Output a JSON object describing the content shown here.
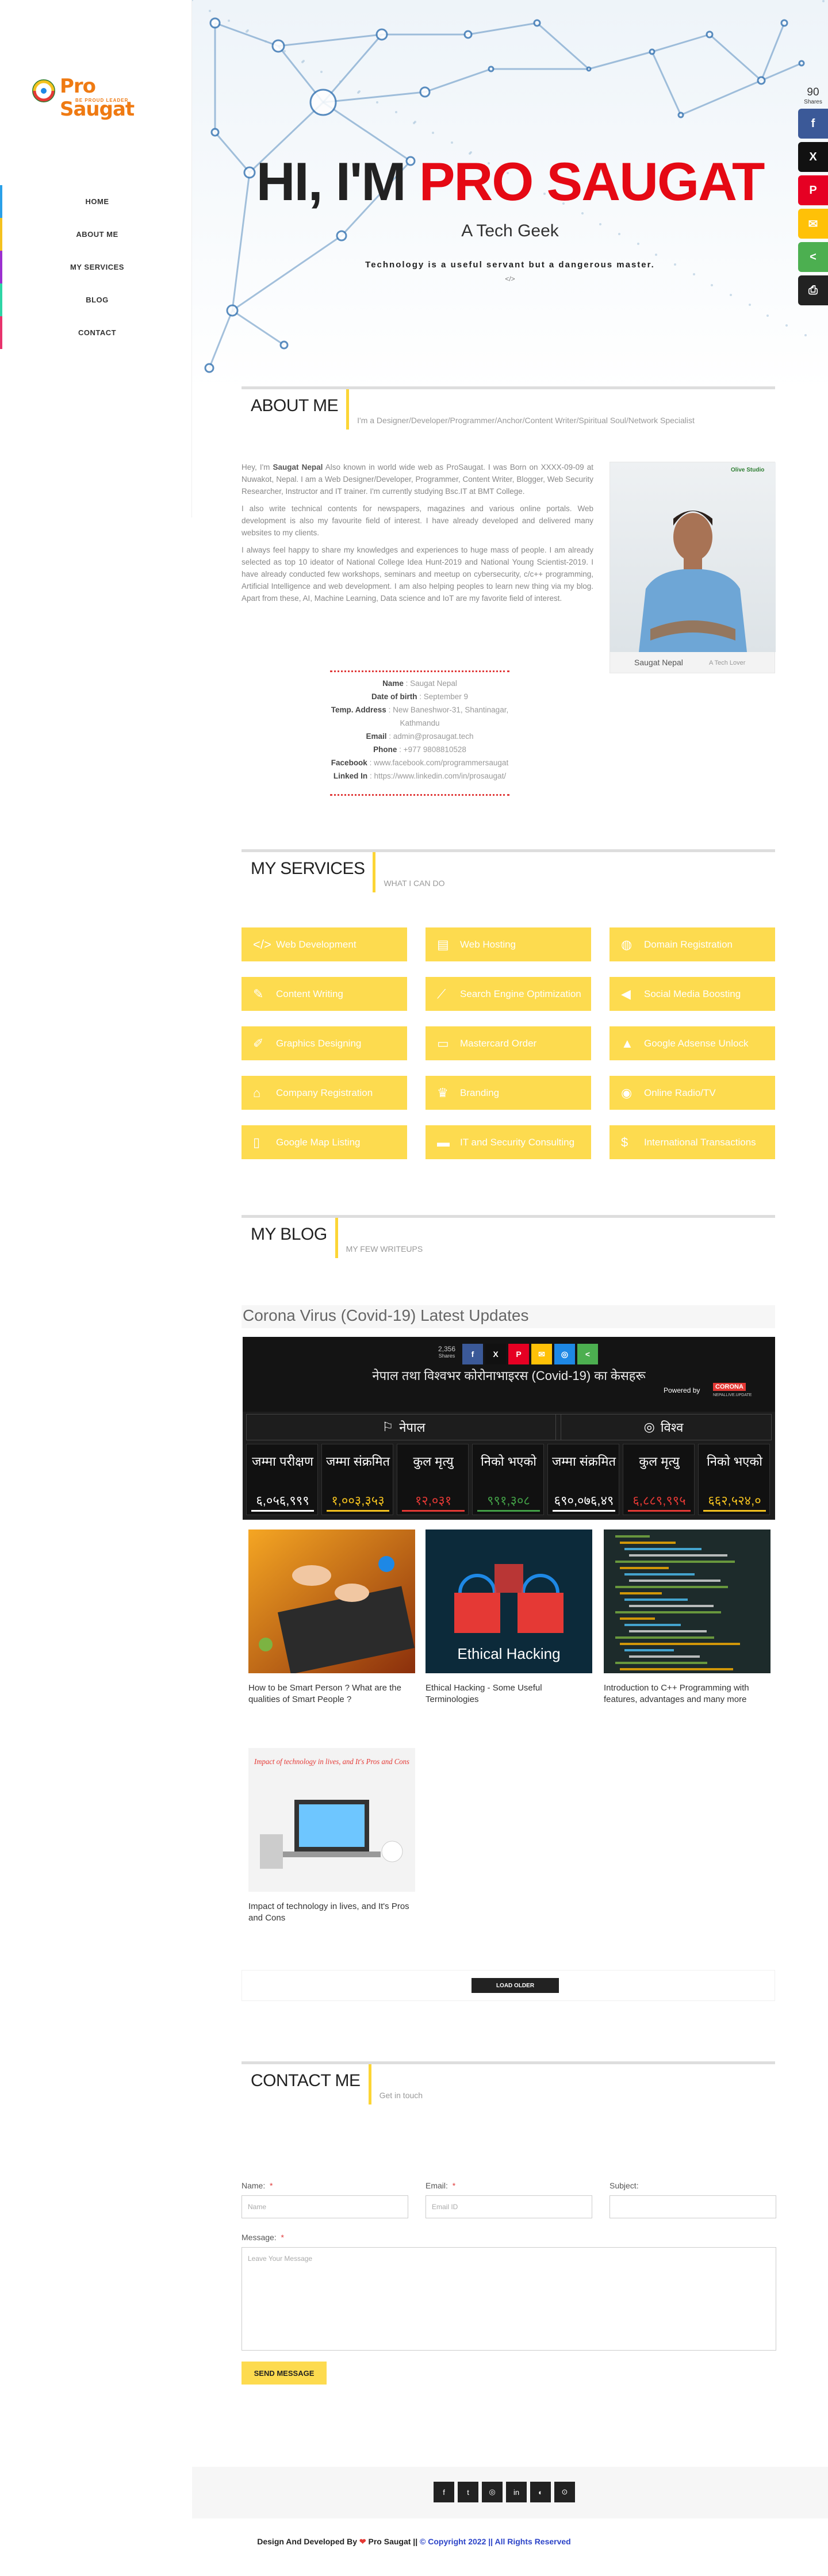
{
  "logo": {
    "title": "Pro Saugat",
    "subtitle": "BE PROUD LEADER"
  },
  "nav": [
    {
      "label": "HOME",
      "color": "#2aa0e8"
    },
    {
      "label": "ABOUT ME",
      "color": "#f4c21f"
    },
    {
      "label": "MY SERVICES",
      "color": "#9b30d0"
    },
    {
      "label": "BLOG",
      "color": "#2ed5a6"
    },
    {
      "label": "CONTACT",
      "color": "#e8336c"
    }
  ],
  "hero": {
    "title_dark": "HI, I'M",
    "title_red": "PRO SAUGAT",
    "subtitle": "A Tech Geek",
    "quote": "Technology is a useful servant but a dangerous master.",
    "code": "</>"
  },
  "share": {
    "count": "90",
    "label": "Shares",
    "buttons": [
      {
        "icon": "f",
        "color": "#3b5998"
      },
      {
        "icon": "X",
        "color": "#111111"
      },
      {
        "icon": "P",
        "color": "#e60023"
      },
      {
        "icon": "✉",
        "color": "#ffc107"
      },
      {
        "icon": "<",
        "color": "#4caf50"
      },
      {
        "icon": "⎙",
        "color": "#222222"
      }
    ]
  },
  "about": {
    "heading": "ABOUT ME",
    "subheading": "I'm a Designer/Developer/Programmer/Anchor/Content Writer/Spiritual Soul/Network Specialist",
    "p1_pre": "Hey, I'm ",
    "p1_name": "Saugat Nepal",
    "p1_post": " Also known in world wide web as ProSaugat. I was Born on XXXX-09-09 at Nuwakot, Nepal. I am a Web Designer/Developer, Programmer, Content Writer, Blogger, Web Security Researcher, Instructor and IT trainer. I'm currently studying Bsc.IT at BMT College.",
    "p2": "I also write technical contents for newspapers, magazines and various online portals. Web development is also my favourite field of interest. I have already developed and delivered many websites to my clients.",
    "p3": "I always feel happy to share my knowledges and experiences to huge mass of people. I am already selected as top 10 ideator of National College Idea Hunt-2019 and National Young Scientist-2019. I have already conducted few workshops, seminars and meetup on cybersecurity, c/c++ programming, Artificial Intelligence and web development. I am also helping peoples to learn new thing via my blog. Apart from these, AI, Machine Learning, Data science and IoT are my favorite field of interest.",
    "card_name": "Saugat Nepal",
    "card_role": "A Tech Lover",
    "card_badge": "Olive Studio",
    "details": [
      {
        "k": "Name",
        "v": "Saugat Nepal"
      },
      {
        "k": "Date of birth",
        "v": "September 9"
      },
      {
        "k": "Temp. Address",
        "v": "New Baneshwor-31, Shantinagar, Kathmandu"
      },
      {
        "k": "Email",
        "v": "admin@prosaugat.tech"
      },
      {
        "k": "Phone",
        "v": "+977 9808810528"
      },
      {
        "k": "Facebook",
        "v": "www.facebook.com/programmersaugat"
      },
      {
        "k": "Linked In",
        "v": "https://www.linkedin.com/in/prosaugat/"
      }
    ]
  },
  "services": {
    "heading": "MY SERVICES",
    "subheading": "WHAT I CAN DO",
    "items": [
      {
        "icon": "</>",
        "label": "Web Development"
      },
      {
        "icon": "▤",
        "label": "Web Hosting"
      },
      {
        "icon": "◍",
        "label": "Domain Registration"
      },
      {
        "icon": "✎",
        "label": "Content Writing"
      },
      {
        "icon": "⟋",
        "label": "Search Engine Optimization"
      },
      {
        "icon": "◀",
        "label": "Social Media Boosting"
      },
      {
        "icon": "✐",
        "label": "Graphics Designing"
      },
      {
        "icon": "▭",
        "label": "Mastercard Order"
      },
      {
        "icon": "▲",
        "label": "Google Adsense Unlock"
      },
      {
        "icon": "⌂",
        "label": "Company Registration"
      },
      {
        "icon": "♛",
        "label": "Branding"
      },
      {
        "icon": "◉",
        "label": "Online Radio/TV"
      },
      {
        "icon": "▯",
        "label": "Google Map Listing"
      },
      {
        "icon": "▬",
        "label": "IT and Security Consulting"
      },
      {
        "icon": "$",
        "label": "International Transactions"
      }
    ]
  },
  "blog": {
    "heading": "MY BLOG",
    "subheading": "MY FEW WRITEUPS",
    "banner_title": "Corona Virus (Covid-19) Latest Updates",
    "covid": {
      "shares_count": "2,356",
      "shares_label": "Shares",
      "title": "नेपाल तथा विश्वभर कोरोनाभाइरस (Covid-19) का केसहरू",
      "powered_by": "Powered by",
      "powered_brand": "CORONA",
      "powered_brand_sub": "NEPALLIVE.UPDATE",
      "nepal_label": "नेपाल",
      "world_label": "विश्व",
      "nepal_stats": [
        {
          "label": "जम्मा परीक्षण",
          "value": "६,०५६,९९९",
          "color": "#ffffff"
        },
        {
          "label": "जम्मा संक्रमित",
          "value": "१,००३,३५३",
          "color": "#f4c21f"
        },
        {
          "label": "कुल मृत्यु",
          "value": "१२,०३१",
          "color": "#e53935"
        },
        {
          "label": "निको भएको",
          "value": "९९१,३०८",
          "color": "#43a047"
        }
      ],
      "world_stats": [
        {
          "label": "जम्मा संक्रमित",
          "value": "६९०,०७६,४९",
          "color": "#ffffff"
        },
        {
          "label": "कुल मृत्यु",
          "value": "६,८८९,९९५",
          "color": "#e53935"
        },
        {
          "label": "निको भएको",
          "value": "६६२,५२४,०",
          "color": "#f4c21f"
        }
      ]
    },
    "posts": [
      {
        "title": "How to be Smart Person ? What are the qualities of Smart People ?",
        "img_caption": ""
      },
      {
        "title": "Ethical Hacking - Some Useful Terminologies",
        "img_caption": "Ethical Hacking"
      },
      {
        "title": "Introduction to C++ Programming with features, advantages and many more",
        "img_caption": ""
      },
      {
        "title": "Impact of technology in lives, and It's Pros and Cons",
        "img_caption": "Impact of technology in lives, and It's Pros and Cons"
      }
    ],
    "load_more": "LOAD OLDER"
  },
  "contact": {
    "heading": "CONTACT ME",
    "subheading": "Get in touch",
    "name_label": "Name:",
    "name_placeholder": "Name",
    "email_label": "Email:",
    "email_placeholder": "Email ID",
    "subject_label": "Subject:",
    "subject_placeholder": "",
    "message_label": "Message:",
    "message_placeholder": "Leave Your Message",
    "send": "SEND MESSAGE",
    "required_mark": "*"
  },
  "footer": {
    "social": [
      "f",
      "t",
      "◎",
      "in",
      "◐",
      "⊙"
    ],
    "credit_pre": "Design And Developed By ",
    "heart": "❤",
    "credit_name": " Pro Saugat ",
    "credit_sep": "|| ",
    "copyright": "© Copyright 2022 || All Rights Reserved"
  }
}
